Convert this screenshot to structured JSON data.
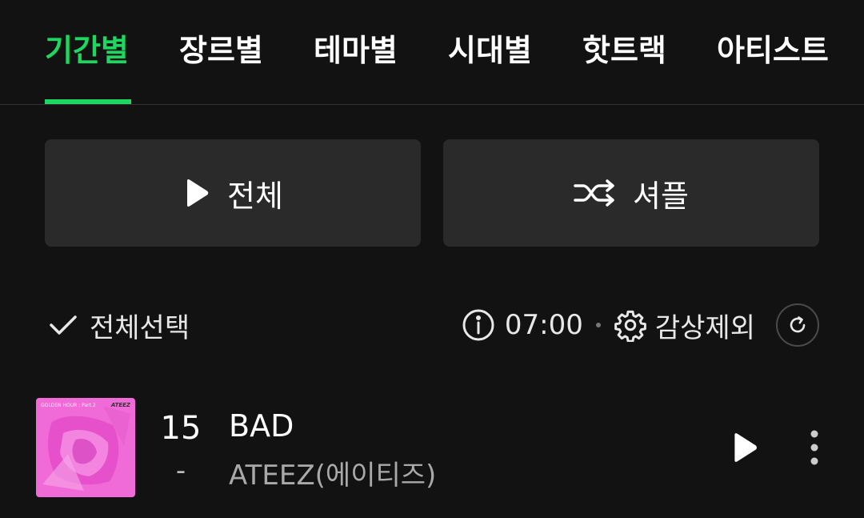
{
  "tabs": [
    {
      "label": "기간별",
      "active": true
    },
    {
      "label": "장르별",
      "active": false
    },
    {
      "label": "테마별",
      "active": false
    },
    {
      "label": "시대별",
      "active": false
    },
    {
      "label": "핫트랙",
      "active": false
    },
    {
      "label": "아티스트",
      "active": false
    }
  ],
  "actions": {
    "play_all_label": "전체",
    "shuffle_label": "셔플"
  },
  "toolbar": {
    "select_all_label": "전체선택",
    "time": "07:00",
    "exclude_label": "감상제외"
  },
  "songs": [
    {
      "rank": "15",
      "rank_change": "-",
      "title": "BAD",
      "artist": "ATEEZ(에이티즈)",
      "album_label_left": "GOLDEN HOUR : Part.2",
      "album_label_right": "ATEEZ"
    }
  ],
  "colors": {
    "accent": "#1ed760",
    "background": "#121212",
    "button_bg": "#2a2a2a",
    "album_pink": "#f06ad8"
  },
  "icons": {
    "play": "play-icon",
    "shuffle": "shuffle-icon",
    "check": "check-icon",
    "info": "info-icon",
    "gear": "gear-icon",
    "refresh": "refresh-icon",
    "more": "more-vertical-icon"
  }
}
